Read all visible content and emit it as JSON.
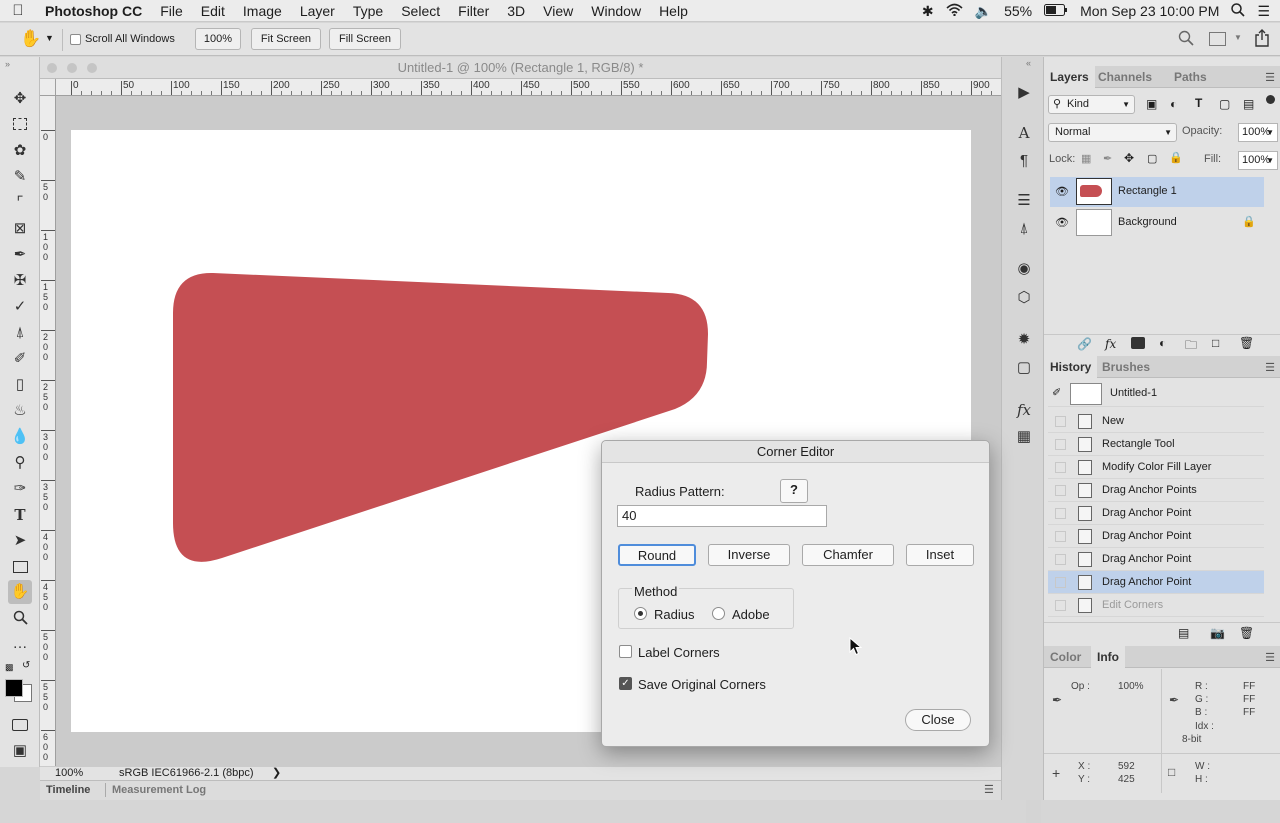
{
  "menubar": {
    "apple": "",
    "app_name": "Photoshop CC",
    "items": [
      "File",
      "Edit",
      "Image",
      "Layer",
      "Type",
      "Select",
      "Filter",
      "3D",
      "View",
      "Window",
      "Help"
    ],
    "battery": "55%",
    "datetime": "Mon Sep 23  10:00 PM"
  },
  "options_bar": {
    "scroll_all_windows": "Scroll All Windows",
    "zoom_100": "100%",
    "fit_screen": "Fit Screen",
    "fill_screen": "Fill Screen"
  },
  "document": {
    "title": "Untitled-1 @ 100% (Rectangle 1, RGB/8) *",
    "hruler_labels": [
      "0",
      "50",
      "100",
      "150",
      "200",
      "250",
      "300",
      "350",
      "400",
      "450",
      "500",
      "550",
      "600",
      "650",
      "700",
      "750",
      "800",
      "850",
      "900"
    ],
    "vruler_labels": [
      "0",
      "5 0",
      "1 0 0",
      "1 5 0",
      "2 0 0",
      "2 5 0",
      "3 0 0",
      "3 5 0",
      "4 0 0",
      "4 5 0",
      "5 0 0",
      "5 5 0",
      "6 0 0"
    ],
    "shape_color": "#c54f53"
  },
  "status": {
    "zoom": "100%",
    "profile": "sRGB IEC61966-2.1 (8bpc)"
  },
  "bottom_tabs": [
    "Timeline",
    "Measurement Log"
  ],
  "layers_panel": {
    "tabs": [
      "Layers",
      "Channels",
      "Paths"
    ],
    "filter_kind": "Kind",
    "blend_mode": "Normal",
    "opacity_label": "Opacity:",
    "opacity_value": "100%",
    "lock_label": "Lock:",
    "fill_label": "Fill:",
    "fill_value": "100%",
    "layers": [
      {
        "name": "Rectangle 1",
        "selected": true
      },
      {
        "name": "Background",
        "selected": false
      }
    ]
  },
  "history_panel": {
    "tabs": [
      "History",
      "Brushes"
    ],
    "snapshot": "Untitled-1",
    "items": [
      "New",
      "Rectangle Tool",
      "Modify Color Fill Layer",
      "Drag Anchor Points",
      "Drag Anchor Point",
      "Drag Anchor Point",
      "Drag Anchor Point",
      "Drag Anchor Point",
      "Edit Corners"
    ],
    "selected_index": 7,
    "dimmed_index": 8
  },
  "info_panel": {
    "tabs": [
      "Color",
      "Info"
    ],
    "op_label": "Op :",
    "op_value": "100%",
    "r_label": "R :",
    "r_value": "FF",
    "g_label": "G :",
    "g_value": "FF",
    "b_label": "B :",
    "b_value": "FF",
    "idx_label": "Idx :",
    "bit": "8-bit",
    "x_label": "X :",
    "x_value": "592",
    "y_label": "Y :",
    "y_value": "425",
    "w_label": "W :",
    "h_label": "H :"
  },
  "corner_editor": {
    "title": "Corner Editor",
    "radius_pattern_label": "Radius Pattern:",
    "help_button": "?",
    "radius_value": "40",
    "buttons": [
      "Round",
      "Inverse",
      "Chamfer",
      "Inset"
    ],
    "method_label": "Method",
    "method_radius": "Radius",
    "method_adobe": "Adobe",
    "label_corners": "Label Corners",
    "label_corners_checked": false,
    "save_original": "Save Original Corners",
    "save_original_checked": true,
    "close_button": "Close"
  }
}
